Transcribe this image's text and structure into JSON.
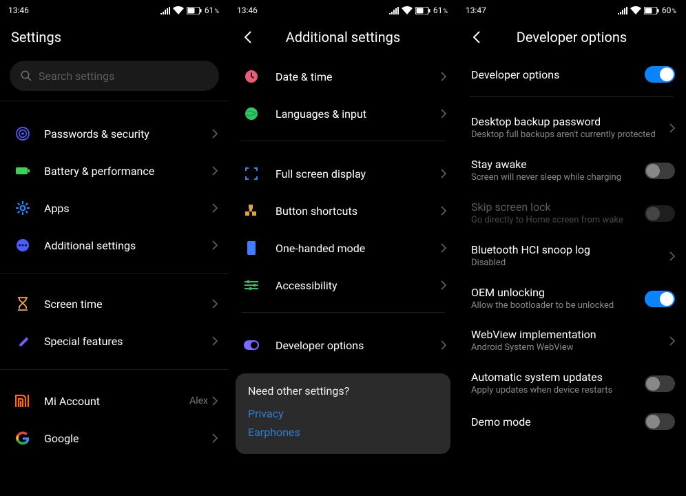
{
  "status": {
    "time_a": "13:46",
    "time_b": "13:46",
    "time_c": "13:47",
    "battery_a": "61",
    "battery_b": "61",
    "battery_c": "60",
    "pct": "%"
  },
  "p1": {
    "title": "Settings",
    "search_placeholder": "Search settings",
    "rows_1": [
      {
        "label": "Passwords & security"
      },
      {
        "label": "Battery & performance"
      },
      {
        "label": "Apps"
      },
      {
        "label": "Additional settings"
      }
    ],
    "rows_2": [
      {
        "label": "Screen time"
      },
      {
        "label": "Special features"
      }
    ],
    "rows_3": [
      {
        "label": "Mi Account",
        "value": "Alex"
      },
      {
        "label": "Google"
      }
    ]
  },
  "p2": {
    "title": "Additional settings",
    "rows_a": [
      {
        "label": "Date & time"
      },
      {
        "label": "Languages & input"
      }
    ],
    "rows_b": [
      {
        "label": "Full screen display"
      },
      {
        "label": "Button shortcuts"
      },
      {
        "label": "One-handed mode"
      },
      {
        "label": "Accessibility"
      }
    ],
    "rows_c": [
      {
        "label": "Developer options"
      }
    ],
    "suggest": {
      "q": "Need other settings?",
      "links": [
        "Privacy",
        "Earphones"
      ]
    }
  },
  "p3": {
    "title": "Developer options",
    "main_toggle": {
      "label": "Developer options",
      "on": true
    },
    "items": [
      {
        "title": "Desktop backup password",
        "sub": "Desktop full backups aren't currently protected",
        "kind": "nav"
      },
      {
        "title": "Stay awake",
        "sub": "Screen will never sleep while charging",
        "kind": "toggle",
        "on": false
      },
      {
        "title": "Skip screen lock",
        "sub": "Go directly to Home screen from wake",
        "kind": "toggle",
        "on": false,
        "disabled": true
      },
      {
        "title": "Bluetooth HCI snoop log",
        "sub": "Disabled",
        "kind": "nav"
      },
      {
        "title": "OEM unlocking",
        "sub": "Allow the bootloader to be unlocked",
        "kind": "toggle",
        "on": true
      },
      {
        "title": "WebView implementation",
        "sub": "Android System WebView",
        "kind": "nav"
      },
      {
        "title": "Automatic system updates",
        "sub": "Apply updates when device restarts",
        "kind": "toggle",
        "on": false
      },
      {
        "title": "Demo mode",
        "sub": "",
        "kind": "toggle",
        "on": false
      }
    ]
  }
}
